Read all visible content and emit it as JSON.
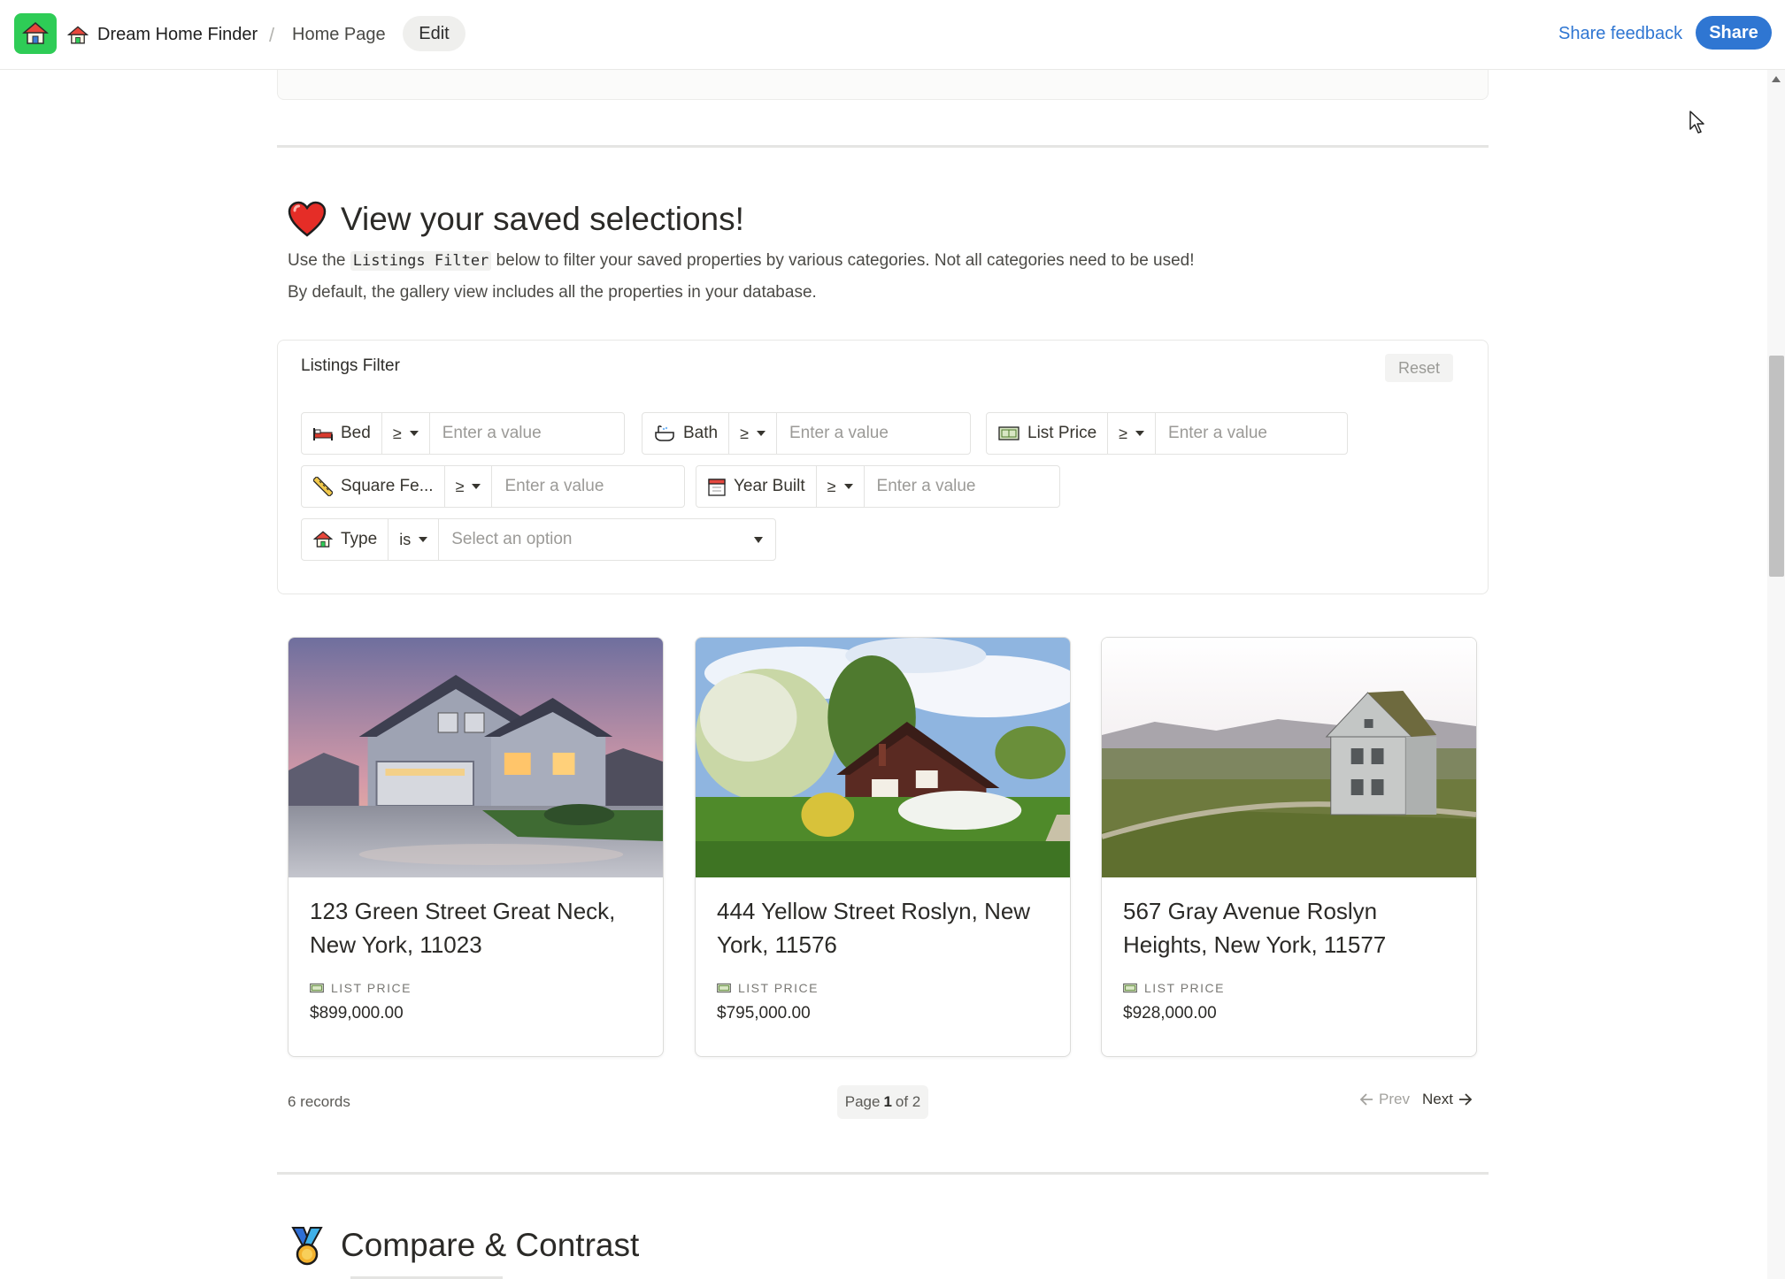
{
  "topbar": {
    "app_name": "Dream Home Finder",
    "separator": "/",
    "page_name": "Home Page",
    "edit_label": "Edit",
    "feedback_label": "Share feedback",
    "share_label": "Share",
    "colors": {
      "app_icon_bg": "#2ecc56",
      "accent": "#2f76d2"
    }
  },
  "saved_section": {
    "heading_emoji": "heart-icon",
    "heading": "View your saved selections!",
    "intro_before": "Use the",
    "intro_code": "Listings Filter",
    "intro_after": "below to filter your saved properties by various categories. Not all categories need to be used!",
    "intro_line2": "By default, the gallery view includes all the properties in your database."
  },
  "filter": {
    "title": "Listings Filter",
    "reset_label": "Reset",
    "fields": [
      {
        "icon": "bed-icon",
        "label": "Bed",
        "operator": "≥",
        "placeholder": "Enter a value"
      },
      {
        "icon": "bathtub-icon",
        "label": "Bath",
        "operator": "≥",
        "placeholder": "Enter a value"
      },
      {
        "icon": "ledger-icon",
        "label": "List Price",
        "operator": "≥",
        "placeholder": "Enter a value"
      },
      {
        "icon": "ruler-icon",
        "label": "Square Fe...",
        "operator": "≥",
        "placeholder": "Enter a value"
      },
      {
        "icon": "calendar-icon",
        "label": "Year Built",
        "operator": "≥",
        "placeholder": "Enter a value"
      },
      {
        "icon": "house-icon",
        "label": "Type",
        "operator": "is",
        "placeholder": "Select an option"
      }
    ]
  },
  "listings": [
    {
      "address": "123 Green Street Great Neck, New York, 11023",
      "price_label": "LIST PRICE",
      "price": "$899,000.00"
    },
    {
      "address": "444 Yellow Street Roslyn, New York, 11576",
      "price_label": "LIST PRICE",
      "price": "$795,000.00"
    },
    {
      "address": "567 Gray Avenue Roslyn Heights, New York, 11577",
      "price_label": "LIST PRICE",
      "price": "$928,000.00"
    }
  ],
  "pagination": {
    "records": "6 records",
    "page_prefix": "Page",
    "page_current": "1",
    "page_suffix": "of 2",
    "prev_label": "Prev",
    "next_label": "Next"
  },
  "compare_section": {
    "heading_emoji": "medal-icon",
    "heading": "Compare & Contrast"
  }
}
